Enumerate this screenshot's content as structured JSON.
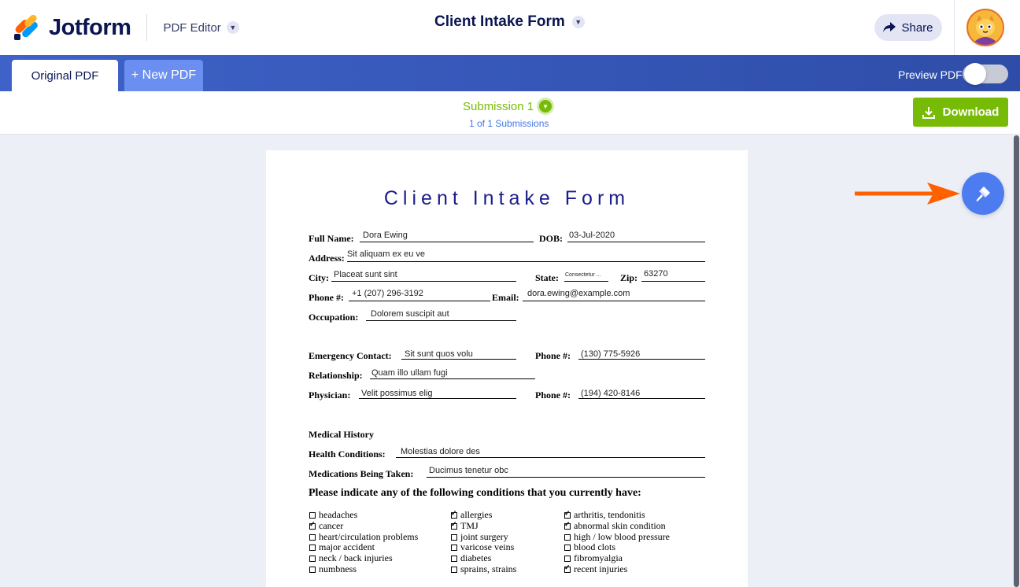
{
  "header": {
    "brand": "Jotform",
    "editor_menu": "PDF Editor",
    "form_title": "Client Intake Form",
    "share_label": "Share"
  },
  "tabs": {
    "original": "Original PDF",
    "new": "+ New PDF",
    "preview_label": "Preview PDF"
  },
  "submission": {
    "title": "Submission 1",
    "count": "1 of 1 Submissions",
    "download_label": "Download"
  },
  "colors": {
    "brand_navy": "#0a1551",
    "band_blue": "#3e62c8",
    "accent_green": "#78bb07",
    "accent_blue": "#4c7cf0",
    "arrow_orange": "#ff6100"
  },
  "icons": {
    "share": "share-arrow-icon",
    "download": "download-icon",
    "brush": "paint-brush-icon",
    "dropdown": "chevron-down-icon"
  },
  "document": {
    "title": "Client Intake Form",
    "labels": {
      "full_name": "Full Name:",
      "dob": "DOB:",
      "address": "Address:",
      "city": "City:",
      "state": "State:",
      "zip": "Zip:",
      "phone": "Phone #:",
      "email": "Email:",
      "occupation": "Occupation:",
      "emergency_contact": "Emergency Contact:",
      "emergency_phone": "Phone #:",
      "relationship": "Relationship:",
      "physician": "Physician:",
      "physician_phone": "Phone #:",
      "medical_history": "Medical History",
      "health_conditions": "Health Conditions:",
      "medications": "Medications Being Taken:"
    },
    "values": {
      "full_name": "Dora Ewing",
      "dob": "03-Jul-2020",
      "address": "Sit aliquam ex eu ve",
      "city": "Placeat sunt sint",
      "state": "Consectetur ...",
      "zip": "63270",
      "phone": "+1 (207) 296-3192",
      "email": "dora.ewing@example.com",
      "occupation": "Dolorem suscipit aut",
      "emergency_contact": "Sit sunt quos volu",
      "emergency_phone": "(130) 775-5926",
      "relationship": "Quam illo ullam fugi",
      "physician": "Velit possimus elig",
      "physician_phone": "(194) 420-8146",
      "health_conditions": "Molestias dolore des",
      "medications": "Ducimus tenetur obc"
    },
    "instruction": "Please indicate any of the following conditions that you currently have:",
    "conditions": {
      "col1": [
        {
          "label": "headaches",
          "checked": false
        },
        {
          "label": "cancer",
          "checked": true
        },
        {
          "label": "heart/circulation problems",
          "checked": false
        },
        {
          "label": "major accident",
          "checked": false
        },
        {
          "label": "neck / back injuries",
          "checked": false
        },
        {
          "label": "numbness",
          "checked": false
        }
      ],
      "col2": [
        {
          "label": "allergies",
          "checked": true
        },
        {
          "label": "TMJ",
          "checked": true
        },
        {
          "label": "joint surgery",
          "checked": false
        },
        {
          "label": "varicose veins",
          "checked": false
        },
        {
          "label": "diabetes",
          "checked": false
        },
        {
          "label": "sprains, strains",
          "checked": false
        }
      ],
      "col3": [
        {
          "label": "arthritis, tendonitis",
          "checked": true
        },
        {
          "label": "abnormal skin condition",
          "checked": true
        },
        {
          "label": "high / low blood pressure",
          "checked": false
        },
        {
          "label": "blood clots",
          "checked": false
        },
        {
          "label": "fibromyalgia",
          "checked": false
        },
        {
          "label": "recent injuries",
          "checked": true
        }
      ]
    }
  }
}
